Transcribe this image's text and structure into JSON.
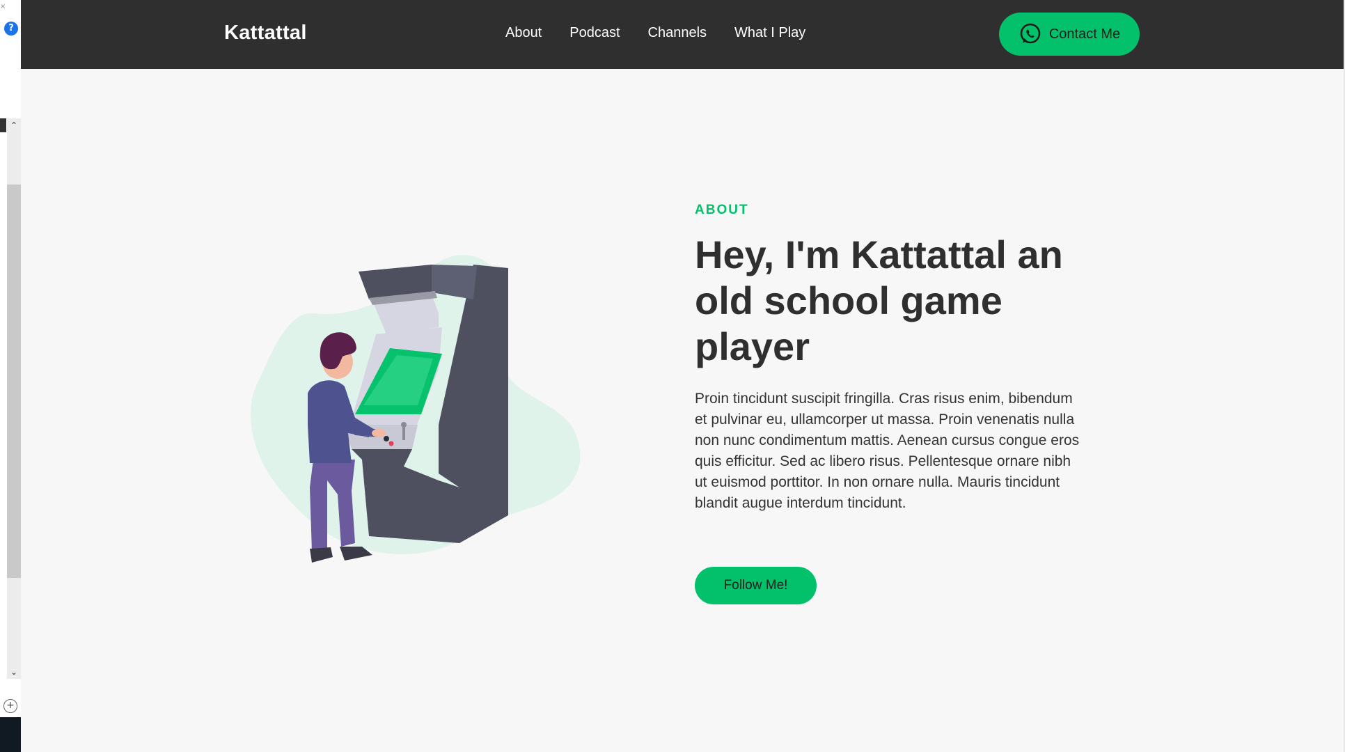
{
  "editor_chrome": {
    "help_icon": "question-mark-icon",
    "help_glyph": "?",
    "scroll_up_glyph": "⌃",
    "scroll_down_glyph": "⌄",
    "zoom_glyph": "+"
  },
  "navbar": {
    "brand": "Kattattal",
    "links": [
      "About",
      "Podcast",
      "Channels",
      "What I Play"
    ],
    "contact_label": "Contact Me",
    "contact_icon": "whatsapp-icon"
  },
  "about": {
    "tag": "ABOUT",
    "headline": "Hey, I'm Kattattal an old school game player",
    "body": "Proin tincidunt suscipit fringilla. Cras risus enim, bibendum et pulvinar eu, ullamcorper ut massa. Proin venenatis nulla non nunc condimentum mattis. Aenean cursus congue eros quis efficitur. Sed ac libero risus. Pellentesque ornare nibh ut euismod porttitor. In non ornare nulla. Mauris tincidunt blandit augue interdum tincidunt.",
    "button_label": "Follow Me!",
    "illustration": "arcade-player-illustration"
  },
  "colors": {
    "accent": "#03c16b",
    "navbar_bg": "#2f2f2f",
    "page_bg": "#f7f7f7",
    "blob": "#dff3ea"
  }
}
